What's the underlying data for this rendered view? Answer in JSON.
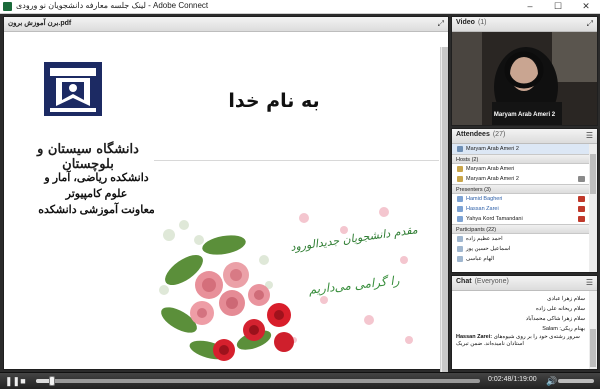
{
  "window": {
    "title": "لینک جلسه معارفه دانشجویان نو ورودی - Adobe Connect",
    "controls": [
      "minimize",
      "maximize",
      "close"
    ]
  },
  "share_pod": {
    "title": "برن آموزش‌ برون.pdf",
    "document": {
      "heading": "به نام خدا",
      "university": "دانشگاه سیستان و بلوچستان",
      "department_lines": [
        "دانشکده ریاضی، آمار و",
        "علوم کامپیوتر",
        "معاونت آموزشی دانشکده"
      ],
      "welcome_line1": "مقدم دانشجویان جدیدالورود",
      "welcome_line2": "را گرامی می‌داریم"
    }
  },
  "video_pod": {
    "title": "Video",
    "count": "(1)",
    "participant_name": "Maryam Arab Ameri 2"
  },
  "attendees_pod": {
    "title": "Attendees",
    "count": "(27)",
    "selected": "Maryam Arab Ameri 2",
    "groups": [
      {
        "label": "Hosts (2)",
        "people": [
          "Maryam Arab Ameri",
          "Maryam Arab Ameri 2"
        ]
      },
      {
        "label": "Presenters (3)",
        "people": [
          "Hamid Bagheri",
          "Hassan Zarei",
          "Yahya Kord Tamandani"
        ]
      },
      {
        "label": "Participants (22)",
        "people": [
          "احمد عظیم زاده",
          "اسماعیل حسین پور",
          "الهام عباسی"
        ]
      }
    ]
  },
  "chat_pod": {
    "title": "Chat",
    "scope": "(Everyone)",
    "messages": [
      {
        "text": "سلام زهرا عبادی",
        "dir": "rtl"
      },
      {
        "text": "سلام ریحانه علی زاده",
        "dir": "rtl"
      },
      {
        "text": "سلام زهرا شاکی محمدآباد",
        "dir": "rtl"
      },
      {
        "text": "بهنام ریکی: Salam",
        "dir": "rtl"
      },
      {
        "sender": "Hassan Zarei:",
        "text": "سرور رشته‌ی خود را بر روی شیوه‌های استادان نامیده‌اند. ضمن تبریک",
        "dir": "ltr"
      }
    ]
  },
  "playback": {
    "current_time": "0:02:48",
    "total_time": "1:19:00",
    "progress": 0.035
  },
  "colors": {
    "pod_border": "#1f1f1f",
    "selected_row": "#dce7f5",
    "presenter_text": "#2b5ea7",
    "logo_blue": "#1c2a63"
  }
}
